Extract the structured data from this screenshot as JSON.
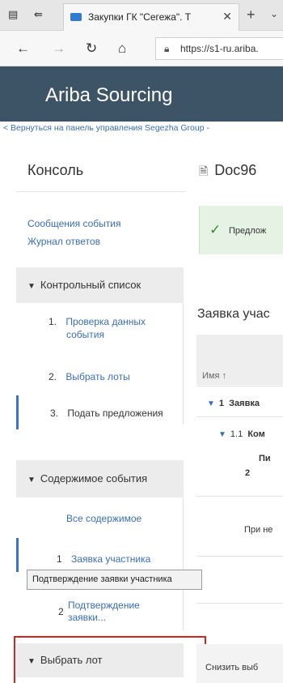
{
  "browser": {
    "tab_title": "Закупки ГК \"Сегежа\". Т",
    "url_text": "https://s1-ru.ariba.",
    "icons": [
      "tab-list-icon",
      "tab-back-icon",
      "close-icon",
      "new-tab-icon",
      "chevron-down-icon",
      "back-icon",
      "forward-icon",
      "refresh-icon",
      "home-icon",
      "lock-icon"
    ]
  },
  "header": {
    "brand": "Ariba Sourcing",
    "back_link": "< Вернуться на панель управления Segezha Group -"
  },
  "console": {
    "title": "Консоль",
    "links": [
      "Сообщения события",
      "Журнал ответов"
    ],
    "checklist": {
      "title": "Контрольный список",
      "items": [
        {
          "num": "1.",
          "label_line1": "Проверка данных",
          "label_line2": "события"
        },
        {
          "num": "2.",
          "label": "Выбрать лоты"
        },
        {
          "num": "3.",
          "label": "Подать предложения"
        }
      ]
    },
    "content": {
      "title": "Содержимое события",
      "all_content": "Все содержимое",
      "items": [
        {
          "num": "1",
          "label": "Заявка участника"
        },
        {
          "num": "2",
          "label_line1": "Подтверждение",
          "label_line2": "заявки..."
        }
      ]
    },
    "select_lot": {
      "title": "Выбрать лот"
    }
  },
  "tooltip": "Подтверждение заявки участника",
  "main": {
    "doc_title": "Doc96",
    "success_text": "Предлож",
    "bid_title": "Заявка учас",
    "column_name": "Имя ↑",
    "rows": [
      {
        "prefix": "1",
        "text": "Заявка"
      },
      {
        "prefix": "1.1",
        "text": "Ком"
      },
      {
        "text_line1": "Пи",
        "text_line2": "2"
      },
      {
        "text": "При не"
      }
    ],
    "bottom_button": "Снизить выб"
  },
  "colors": {
    "ariba_header": "#3d5466",
    "link": "#3a6eb5",
    "highlight_box": "#d9231f",
    "success_bg": "#e6f2e3"
  }
}
